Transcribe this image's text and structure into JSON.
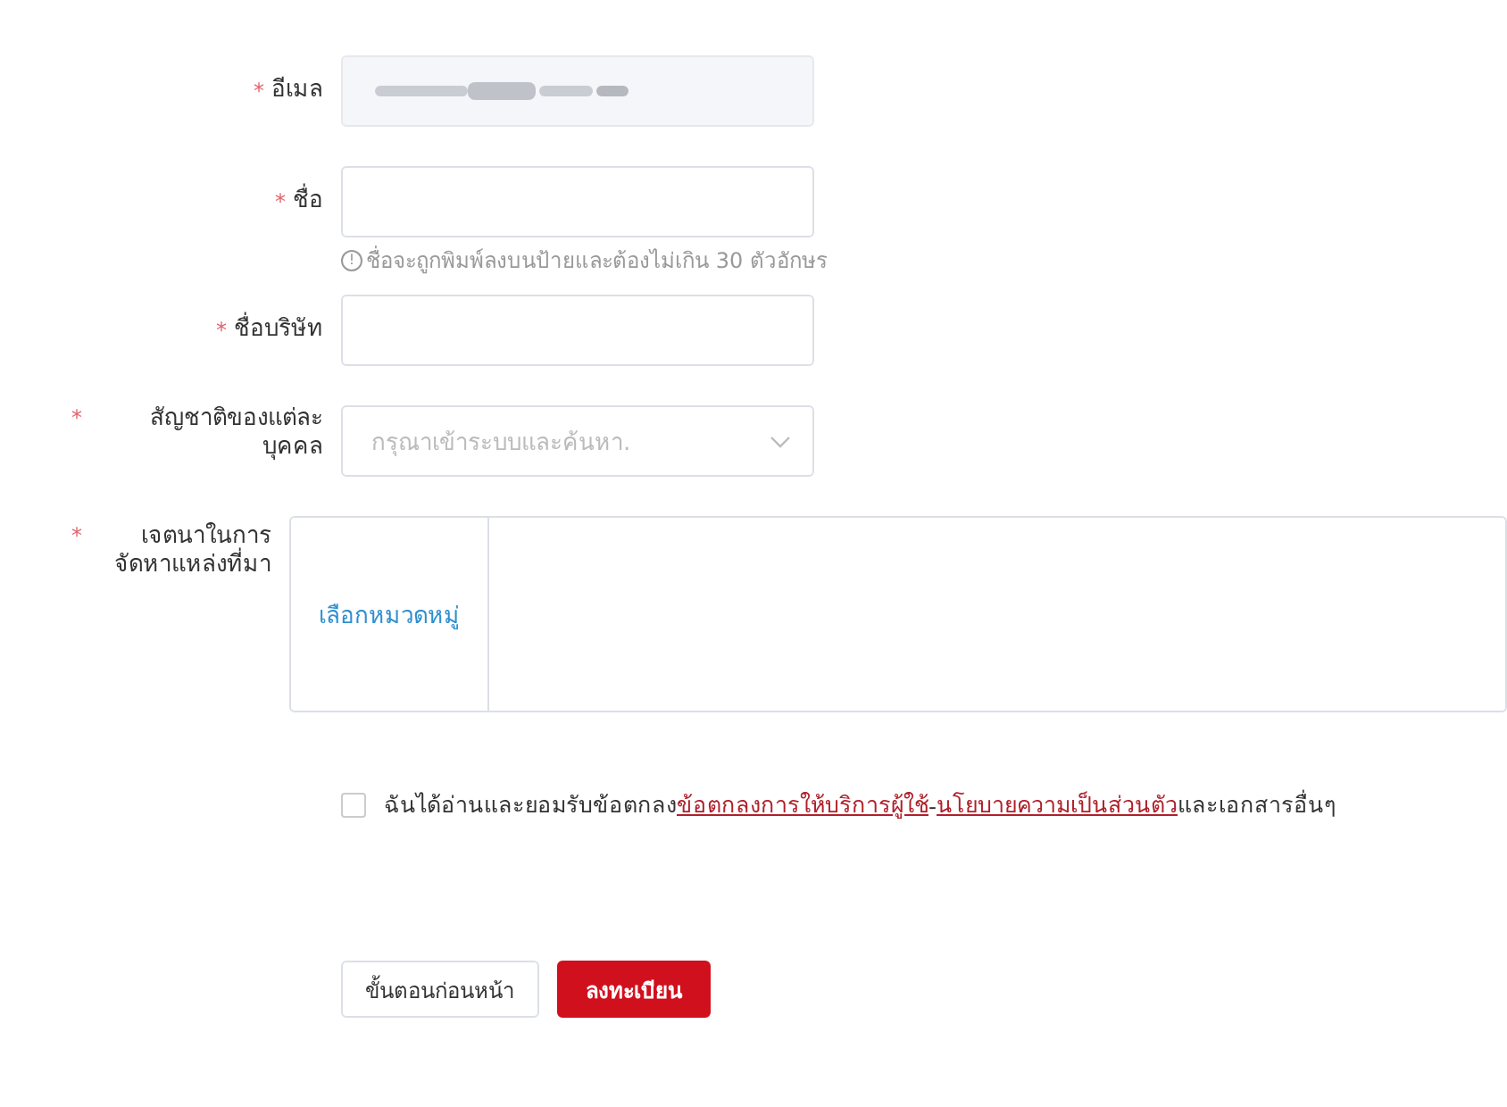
{
  "fields": [
    {
      "kind": "text",
      "label": "อีเมล",
      "required": "*",
      "disabled": true
    },
    {
      "kind": "text",
      "label": "ชื่อ",
      "required": "*",
      "disabled": false,
      "hint_icon": "!",
      "hint": "ชื่อจะถูกพิมพ์ลงบนป้ายและต้องไม่เกิน 30 ตัวอักษร"
    },
    {
      "kind": "text",
      "label": "ชื่อบริษัท",
      "required": "*",
      "disabled": false
    },
    {
      "kind": "select",
      "label": "สัญชาติของแต่ละบุคคล",
      "required": "*",
      "placeholder": "กรุณาเข้าระบบและค้นหา."
    },
    {
      "kind": "category",
      "label": "เจตนาในการจัดหาแหล่งที่มา",
      "required": "*",
      "action": "เลือกหมวดหมู่"
    }
  ],
  "agreement": {
    "checked": false,
    "text": "ฉันได้อ่านและยอมรับข้อตกลง",
    "link_1": "ข้อตกลงการให้บริการผู้ใช้",
    "separator": "-",
    "link_2": "นโยบายความเป็นส่วนตัว",
    "suffix": "และเอกสารอื่นๆ"
  },
  "buttons": [
    {
      "kind": "secondary",
      "label": "ขั้นตอนก่อนหน้า"
    },
    {
      "kind": "primary",
      "label": "ลงทะเบียน"
    }
  ]
}
